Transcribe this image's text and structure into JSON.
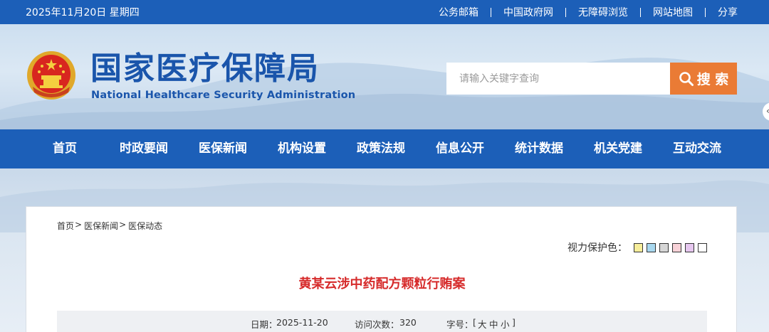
{
  "topbar": {
    "date": "2025年11月20日 星期四",
    "links": [
      "公务邮箱",
      "中国政府网",
      "无障碍浏览",
      "网站地图",
      "分享"
    ]
  },
  "header": {
    "title_cn": "国家医疗保障局",
    "title_en": "National Healthcare Security Administration",
    "search_placeholder": "请输入关键字查询",
    "search_button": "搜 索",
    "side_tab_glyph": "‹"
  },
  "nav": [
    "首页",
    "时政要闻",
    "医保新闻",
    "机构设置",
    "政策法规",
    "信息公开",
    "统计数据",
    "机关党建",
    "互动交流"
  ],
  "breadcrumb": {
    "items": [
      "首页",
      "医保新闻",
      "医保动态"
    ],
    "separator": ">"
  },
  "eye_protection": {
    "label": "视力保护色：",
    "swatches": [
      "#f6ed9a",
      "#a8d8ef",
      "#d6d6d6",
      "#f8d2d8",
      "#e6c7ef",
      "#ffffff"
    ]
  },
  "article": {
    "title": "黄某云涉中药配方颗粒行贿案",
    "meta": {
      "date_label": "日期：",
      "date": "2025-11-20",
      "views_label": "访问次数：",
      "views": "320",
      "font_label": "字号：",
      "font_open": "[",
      "font_large": "大",
      "font_medium": "中",
      "font_small": "小",
      "font_close": "]"
    }
  },
  "colors": {
    "primary_blue": "#1c5fb8",
    "search_orange": "#ea7b35",
    "title_red": "#d62b2b"
  }
}
